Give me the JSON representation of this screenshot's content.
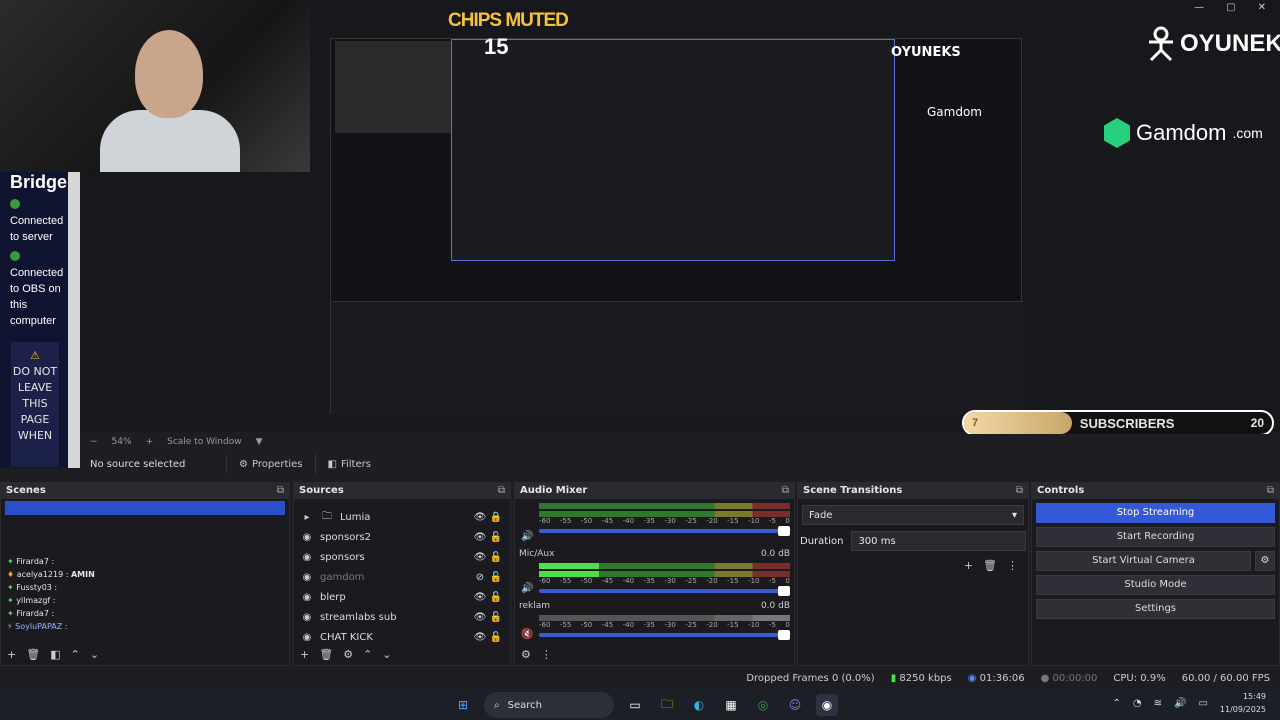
{
  "preview": {
    "chips_muted": "CHIPS MUTED",
    "chips_count": "15",
    "oyuneks": "OYUNEKS",
    "gamdom": "Gamdom",
    "gamdom_tld": ".com",
    "subscribers_label": "SUBSCRIBERS",
    "subscribers_current": "7",
    "subscribers_goal": "20",
    "subscribers_progress_fraction": 0.35
  },
  "bridge": {
    "title": "Bridge",
    "status1": "Connected to server",
    "status2": "Connected to OBS on this computer",
    "warning": "DO NOT LEAVE THIS PAGE WHEN"
  },
  "zoom": {
    "level": "54%",
    "mode": "Scale to Window"
  },
  "source_toolbar": {
    "no_source": "No source selected",
    "properties": "Properties",
    "filters": "Filters"
  },
  "scenes": {
    "title": "Scenes",
    "chat": [
      {
        "user": "Firarda7",
        "color": "#e6e6e6"
      },
      {
        "user": "acelya1219",
        "msg": "AMIN",
        "color": "#e6e6e6"
      },
      {
        "user": "Fussty03",
        "color": "#e6e6e6"
      },
      {
        "user": "yllmazgf",
        "color": "#e6e6e6"
      },
      {
        "user": "Firarda7",
        "color": "#e6e6e6"
      },
      {
        "user": "SoyluPAPAZ",
        "color": "#8fb8ff"
      }
    ]
  },
  "sources": {
    "title": "Sources",
    "items": [
      {
        "name": "Lumia",
        "type": "folder",
        "visible": true
      },
      {
        "name": "sponsors2",
        "type": "source",
        "visible": true
      },
      {
        "name": "sponsors",
        "type": "source",
        "visible": true
      },
      {
        "name": "gamdom",
        "type": "source",
        "visible": false
      },
      {
        "name": "blerp",
        "type": "source",
        "visible": true
      },
      {
        "name": "streamlabs sub",
        "type": "source",
        "visible": true
      },
      {
        "name": "CHAT KICK",
        "type": "source",
        "visible": true
      }
    ]
  },
  "mixer": {
    "title": "Audio Mixer",
    "ticks": [
      "-60",
      "-55",
      "-50",
      "-45",
      "-40",
      "-35",
      "-30",
      "-25",
      "-20",
      "-15",
      "-10",
      "-5",
      "0"
    ],
    "tracks": [
      {
        "name": "",
        "db": ""
      },
      {
        "name": "Mic/Aux",
        "db": "0.0 dB"
      },
      {
        "name": "reklam",
        "db": "0.0 dB"
      }
    ]
  },
  "transitions": {
    "title": "Scene Transitions",
    "selected": "Fade",
    "duration_label": "Duration",
    "duration_value": "300 ms"
  },
  "controls": {
    "title": "Controls",
    "stop_streaming": "Stop Streaming",
    "start_recording": "Start Recording",
    "start_virtual_camera": "Start Virtual Camera",
    "studio_mode": "Studio Mode",
    "settings": "Settings"
  },
  "status": {
    "dropped": "Dropped Frames 0 (0.0%)",
    "bitrate": "8250 kbps",
    "stream_time": "01:36:06",
    "rec_time": "00:00:00",
    "cpu": "CPU: 0.9%",
    "fps": "60.00 / 60.00 FPS"
  },
  "taskbar": {
    "search": "Search",
    "time": "15:49",
    "date": "11/09/2025"
  }
}
